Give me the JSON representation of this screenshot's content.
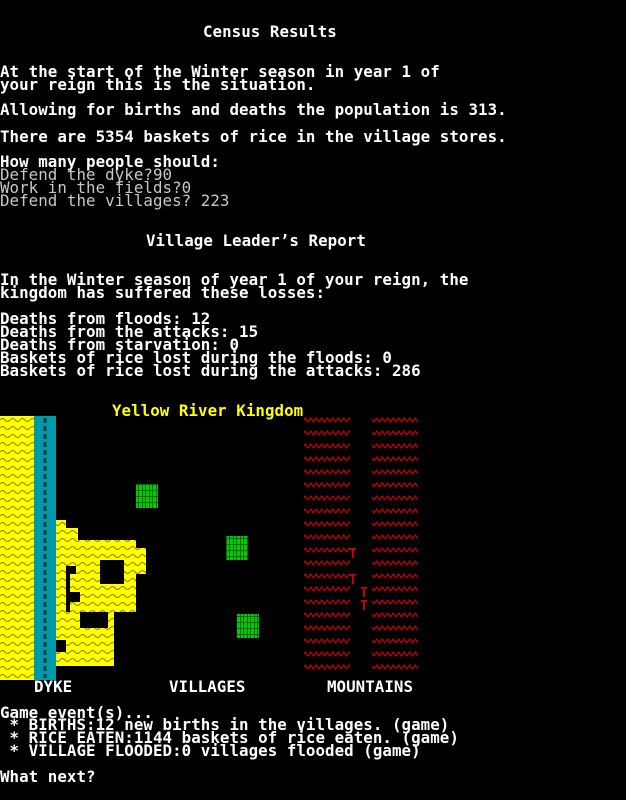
{
  "census": {
    "title": "Census Results",
    "line1": "At the start of the Winter season in year 1 of",
    "line2": "your reign this is the situation.",
    "population": "Allowing for births and deaths the population is 313.",
    "rice": "There are 5354 baskets of rice in the village stores.",
    "question": "How many people should:",
    "q_dyke": "Defend the dyke?90",
    "q_fields": "Work in the fields?0",
    "q_villages": "Defend the villages? 223"
  },
  "report": {
    "title": "Village Leader’s Report",
    "intro1": "In the Winter season of year 1 of your reign, the",
    "intro2": "kingdom has suffered these losses:",
    "floods": "Deaths from floods: 12",
    "attacks": "Deaths from the attacks: 15",
    "starvation": "Deaths from starvation: 0",
    "rice_floods": "Baskets of rice lost during the floods: 0",
    "rice_attacks": "Baskets of rice lost during the attacks: 286"
  },
  "map": {
    "title": "Yellow River Kingdom",
    "label_dyke": "DYKE",
    "label_villages": "VILLAGES",
    "label_mountains": "MOUNTAINS",
    "village_glyph": "##",
    "thief_glyph": "T",
    "mountain_glyph": "^^^^^",
    "colors": {
      "river": "#ffff00",
      "dyke": "#0099a8",
      "village": "#00cc00",
      "mountain": "#cc0000"
    }
  },
  "events": {
    "header": "Game event(s)...",
    "items": [
      " * BIRTHS:12 new births in the villages. (game)",
      " * RICE EATEN:1144 baskets of rice eaten. (game)",
      " * VILLAGE FLOODED:0 villages flooded (game)"
    ]
  },
  "prompt": "What next?"
}
